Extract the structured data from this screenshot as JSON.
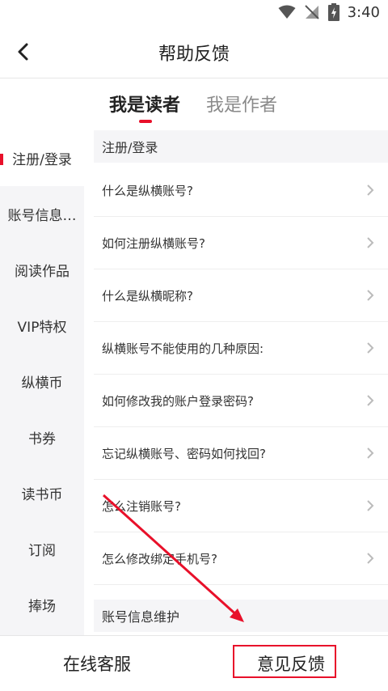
{
  "status_bar": {
    "time": "3:40",
    "icons": [
      "wifi-icon",
      "signal-off-icon",
      "battery-charging-icon"
    ]
  },
  "header": {
    "title": "帮助反馈",
    "back_icon": "chevron-left-icon"
  },
  "tabs": [
    {
      "label": "我是读者",
      "active": true
    },
    {
      "label": "我是作者",
      "active": false
    }
  ],
  "sidebar": {
    "items": [
      {
        "label": "注册/登录",
        "active": true
      },
      {
        "label": "账号信息…",
        "active": false
      },
      {
        "label": "阅读作品",
        "active": false
      },
      {
        "label": "VIP特权",
        "active": false
      },
      {
        "label": "纵横币",
        "active": false
      },
      {
        "label": "书券",
        "active": false
      },
      {
        "label": "读书币",
        "active": false
      },
      {
        "label": "订阅",
        "active": false
      },
      {
        "label": "捧场",
        "active": false
      }
    ]
  },
  "content": {
    "sections": [
      {
        "title": "注册/登录",
        "questions": [
          "什么是纵横账号?",
          "如何注册纵横账号?",
          "什么是纵横昵称?",
          "纵横账号不能使用的几种原因:",
          "如何修改我的账户登录密码?",
          "忘记纵横账号、密码如何找回?",
          "怎么注销账号?",
          "怎么修改绑定手机号?"
        ]
      },
      {
        "title": "账号信息维护",
        "questions": []
      }
    ]
  },
  "bottom_bar": {
    "left_label": "在线客服",
    "right_label": "意见反馈"
  },
  "colors": {
    "accent": "#e8102a",
    "sidebar_bg": "#f5f5f7",
    "inactive_text": "#8a8a8a"
  }
}
